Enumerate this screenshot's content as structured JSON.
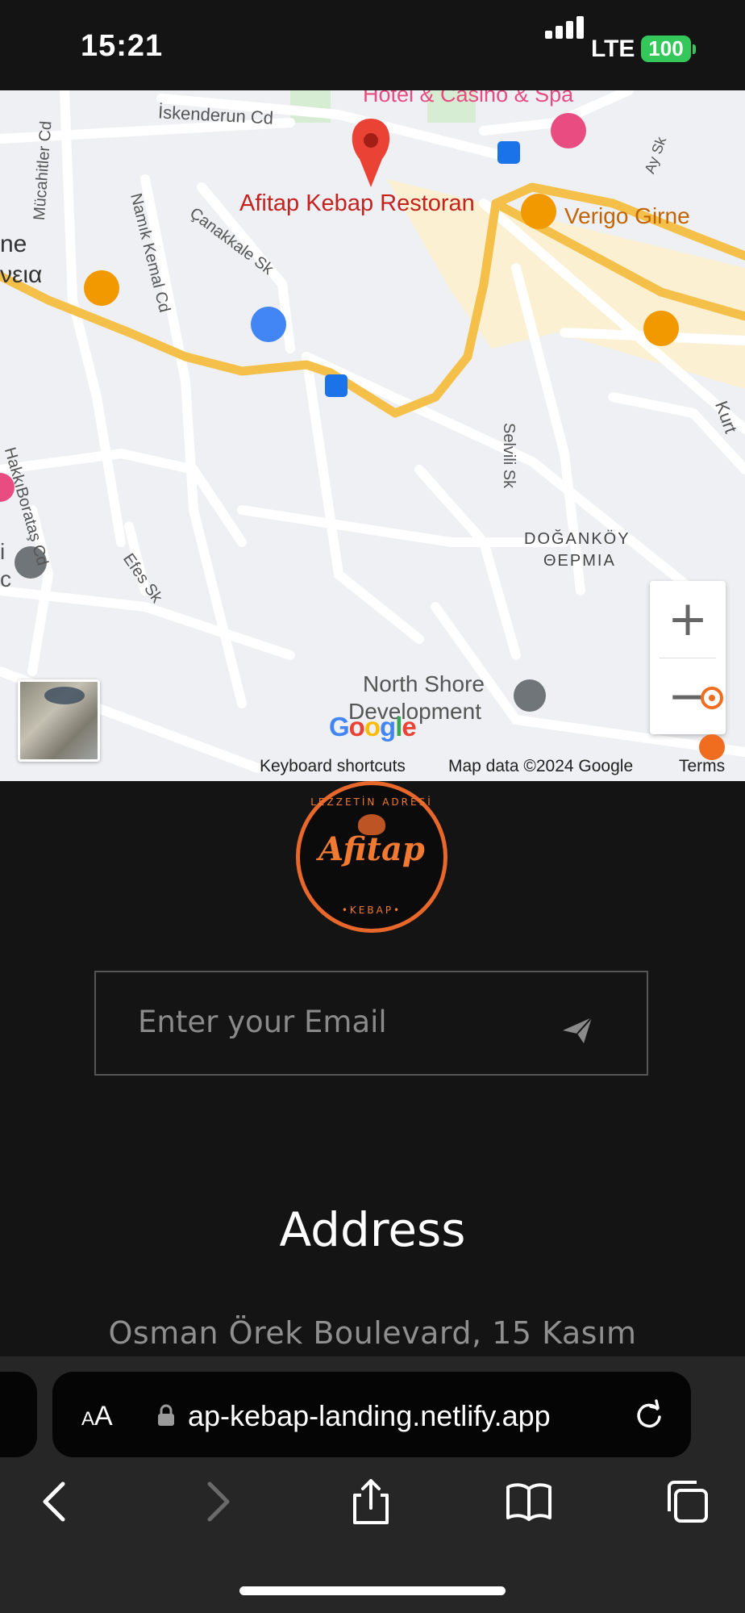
{
  "status": {
    "time": "15:21",
    "network": "LTE",
    "battery": "100"
  },
  "map": {
    "labels": {
      "hotel": "Hotel & Casino & Spa",
      "iskenderun": "İskenderun Cd",
      "mucahitler": "Mücahitler Cd",
      "namik": "Namık Kemal Cd",
      "canakkale": "Çanakkale Sk",
      "afitap": "Afitap Kebap Restoran",
      "verigo": "Verigo Girne",
      "ne": "ne",
      "veia": "νεια",
      "hakki": "HakkıBorataş Cd",
      "selvili": "Selvili Sk",
      "efes": "Efes Sk",
      "ay": "Ay Sk",
      "kurt": "Kurt",
      "dogankoy": "DOĞANKÖY",
      "thermia": "ΘΕΡΜΙΑ",
      "north_shore_1": "North Shore",
      "north_shore_2": "Development",
      "left_i": "i",
      "left_c": "c"
    },
    "google_logo": "Google",
    "attribution": {
      "shortcuts": "Keyboard shortcuts",
      "map_data": "Map data ©2024 Google",
      "terms": "Terms"
    },
    "zoom_in": "+",
    "zoom_out": "−"
  },
  "logo": {
    "top_text": "LEZZETİN ADRESİ",
    "name": "Afitap",
    "bottom_text": "•KEBAP•"
  },
  "newsletter": {
    "placeholder": "Enter your Email"
  },
  "address": {
    "title": "Address",
    "line": "Osman Örek Boulevard, 15 Kasım"
  },
  "browser": {
    "aa_small": "A",
    "aa_large": "A",
    "url": "ap-kebap-landing.netlify.app"
  },
  "colors": {
    "accent": "#e8672a",
    "background": "#141414",
    "road": "#f5c04a",
    "pin_red": "#ea4335"
  }
}
